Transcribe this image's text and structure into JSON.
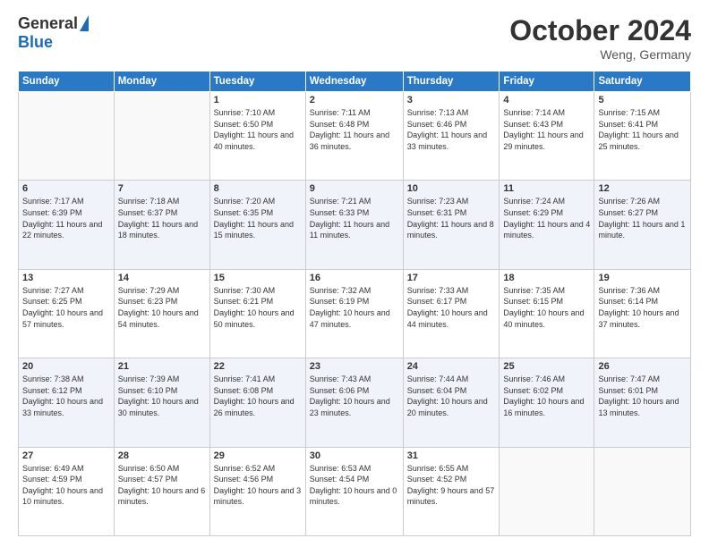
{
  "header": {
    "logo_general": "General",
    "logo_blue": "Blue",
    "month_title": "October 2024",
    "location": "Weng, Germany"
  },
  "weekdays": [
    "Sunday",
    "Monday",
    "Tuesday",
    "Wednesday",
    "Thursday",
    "Friday",
    "Saturday"
  ],
  "weeks": [
    [
      {
        "day": "",
        "sunrise": "",
        "sunset": "",
        "daylight": ""
      },
      {
        "day": "",
        "sunrise": "",
        "sunset": "",
        "daylight": ""
      },
      {
        "day": "1",
        "sunrise": "Sunrise: 7:10 AM",
        "sunset": "Sunset: 6:50 PM",
        "daylight": "Daylight: 11 hours and 40 minutes."
      },
      {
        "day": "2",
        "sunrise": "Sunrise: 7:11 AM",
        "sunset": "Sunset: 6:48 PM",
        "daylight": "Daylight: 11 hours and 36 minutes."
      },
      {
        "day": "3",
        "sunrise": "Sunrise: 7:13 AM",
        "sunset": "Sunset: 6:46 PM",
        "daylight": "Daylight: 11 hours and 33 minutes."
      },
      {
        "day": "4",
        "sunrise": "Sunrise: 7:14 AM",
        "sunset": "Sunset: 6:43 PM",
        "daylight": "Daylight: 11 hours and 29 minutes."
      },
      {
        "day": "5",
        "sunrise": "Sunrise: 7:15 AM",
        "sunset": "Sunset: 6:41 PM",
        "daylight": "Daylight: 11 hours and 25 minutes."
      }
    ],
    [
      {
        "day": "6",
        "sunrise": "Sunrise: 7:17 AM",
        "sunset": "Sunset: 6:39 PM",
        "daylight": "Daylight: 11 hours and 22 minutes."
      },
      {
        "day": "7",
        "sunrise": "Sunrise: 7:18 AM",
        "sunset": "Sunset: 6:37 PM",
        "daylight": "Daylight: 11 hours and 18 minutes."
      },
      {
        "day": "8",
        "sunrise": "Sunrise: 7:20 AM",
        "sunset": "Sunset: 6:35 PM",
        "daylight": "Daylight: 11 hours and 15 minutes."
      },
      {
        "day": "9",
        "sunrise": "Sunrise: 7:21 AM",
        "sunset": "Sunset: 6:33 PM",
        "daylight": "Daylight: 11 hours and 11 minutes."
      },
      {
        "day": "10",
        "sunrise": "Sunrise: 7:23 AM",
        "sunset": "Sunset: 6:31 PM",
        "daylight": "Daylight: 11 hours and 8 minutes."
      },
      {
        "day": "11",
        "sunrise": "Sunrise: 7:24 AM",
        "sunset": "Sunset: 6:29 PM",
        "daylight": "Daylight: 11 hours and 4 minutes."
      },
      {
        "day": "12",
        "sunrise": "Sunrise: 7:26 AM",
        "sunset": "Sunset: 6:27 PM",
        "daylight": "Daylight: 11 hours and 1 minute."
      }
    ],
    [
      {
        "day": "13",
        "sunrise": "Sunrise: 7:27 AM",
        "sunset": "Sunset: 6:25 PM",
        "daylight": "Daylight: 10 hours and 57 minutes."
      },
      {
        "day": "14",
        "sunrise": "Sunrise: 7:29 AM",
        "sunset": "Sunset: 6:23 PM",
        "daylight": "Daylight: 10 hours and 54 minutes."
      },
      {
        "day": "15",
        "sunrise": "Sunrise: 7:30 AM",
        "sunset": "Sunset: 6:21 PM",
        "daylight": "Daylight: 10 hours and 50 minutes."
      },
      {
        "day": "16",
        "sunrise": "Sunrise: 7:32 AM",
        "sunset": "Sunset: 6:19 PM",
        "daylight": "Daylight: 10 hours and 47 minutes."
      },
      {
        "day": "17",
        "sunrise": "Sunrise: 7:33 AM",
        "sunset": "Sunset: 6:17 PM",
        "daylight": "Daylight: 10 hours and 44 minutes."
      },
      {
        "day": "18",
        "sunrise": "Sunrise: 7:35 AM",
        "sunset": "Sunset: 6:15 PM",
        "daylight": "Daylight: 10 hours and 40 minutes."
      },
      {
        "day": "19",
        "sunrise": "Sunrise: 7:36 AM",
        "sunset": "Sunset: 6:14 PM",
        "daylight": "Daylight: 10 hours and 37 minutes."
      }
    ],
    [
      {
        "day": "20",
        "sunrise": "Sunrise: 7:38 AM",
        "sunset": "Sunset: 6:12 PM",
        "daylight": "Daylight: 10 hours and 33 minutes."
      },
      {
        "day": "21",
        "sunrise": "Sunrise: 7:39 AM",
        "sunset": "Sunset: 6:10 PM",
        "daylight": "Daylight: 10 hours and 30 minutes."
      },
      {
        "day": "22",
        "sunrise": "Sunrise: 7:41 AM",
        "sunset": "Sunset: 6:08 PM",
        "daylight": "Daylight: 10 hours and 26 minutes."
      },
      {
        "day": "23",
        "sunrise": "Sunrise: 7:43 AM",
        "sunset": "Sunset: 6:06 PM",
        "daylight": "Daylight: 10 hours and 23 minutes."
      },
      {
        "day": "24",
        "sunrise": "Sunrise: 7:44 AM",
        "sunset": "Sunset: 6:04 PM",
        "daylight": "Daylight: 10 hours and 20 minutes."
      },
      {
        "day": "25",
        "sunrise": "Sunrise: 7:46 AM",
        "sunset": "Sunset: 6:02 PM",
        "daylight": "Daylight: 10 hours and 16 minutes."
      },
      {
        "day": "26",
        "sunrise": "Sunrise: 7:47 AM",
        "sunset": "Sunset: 6:01 PM",
        "daylight": "Daylight: 10 hours and 13 minutes."
      }
    ],
    [
      {
        "day": "27",
        "sunrise": "Sunrise: 6:49 AM",
        "sunset": "Sunset: 4:59 PM",
        "daylight": "Daylight: 10 hours and 10 minutes."
      },
      {
        "day": "28",
        "sunrise": "Sunrise: 6:50 AM",
        "sunset": "Sunset: 4:57 PM",
        "daylight": "Daylight: 10 hours and 6 minutes."
      },
      {
        "day": "29",
        "sunrise": "Sunrise: 6:52 AM",
        "sunset": "Sunset: 4:56 PM",
        "daylight": "Daylight: 10 hours and 3 minutes."
      },
      {
        "day": "30",
        "sunrise": "Sunrise: 6:53 AM",
        "sunset": "Sunset: 4:54 PM",
        "daylight": "Daylight: 10 hours and 0 minutes."
      },
      {
        "day": "31",
        "sunrise": "Sunrise: 6:55 AM",
        "sunset": "Sunset: 4:52 PM",
        "daylight": "Daylight: 9 hours and 57 minutes."
      },
      {
        "day": "",
        "sunrise": "",
        "sunset": "",
        "daylight": ""
      },
      {
        "day": "",
        "sunrise": "",
        "sunset": "",
        "daylight": ""
      }
    ]
  ]
}
